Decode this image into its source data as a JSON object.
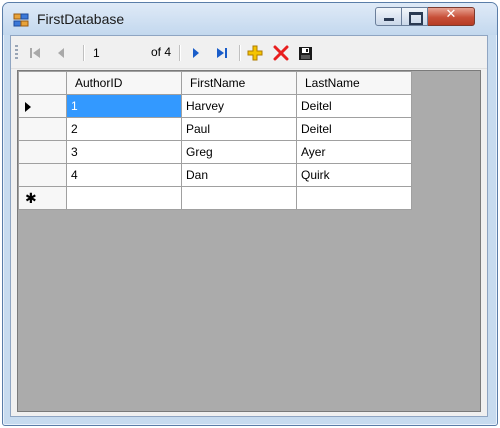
{
  "window": {
    "title": "FirstDatabase",
    "minimize_label": "",
    "maximize_label": "",
    "close_label": "✕"
  },
  "toolbar": {
    "position_value": "1",
    "count_label": "of 4",
    "icons": [
      "move-first-icon",
      "move-previous-icon",
      "move-next-icon",
      "move-last-icon",
      "add-new-icon",
      "delete-icon",
      "save-icon"
    ],
    "colors": {
      "nav_disabled": "#a9a9a9",
      "nav_active": "#1a5dc9",
      "add": "#e8b400",
      "delete": "#e81e1e",
      "save": "#1a1a1a"
    }
  },
  "grid": {
    "columns": [
      "AuthorID",
      "FirstName",
      "LastName"
    ],
    "rows": [
      [
        "1",
        "Harvey",
        "Deitel"
      ],
      [
        "2",
        "Paul",
        "Deitel"
      ],
      [
        "3",
        "Greg",
        "Ayer"
      ],
      [
        "4",
        "Dan",
        "Quirk"
      ]
    ],
    "new_row_marker": "✱",
    "selection_color": "#3399ff"
  }
}
